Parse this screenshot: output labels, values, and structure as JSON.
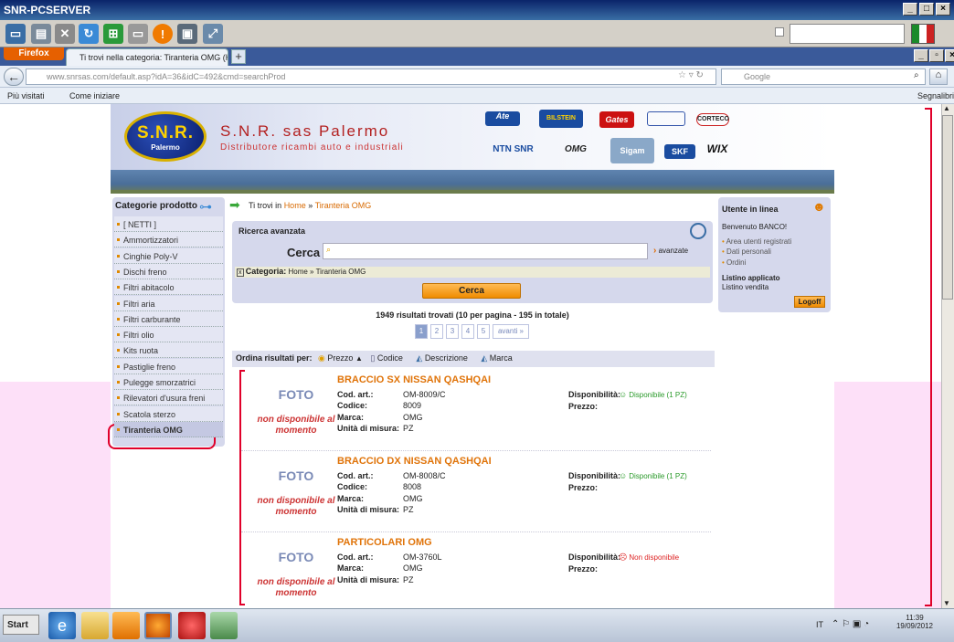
{
  "window": {
    "title": "SNR-PCSERVER"
  },
  "firefox": {
    "button_label": "Firefox",
    "tab_title": "Ti trovi nella categoria: Tiranteria OMG (Hom...",
    "url": "www.snrsas.com/default.asp?idA=36&idC=492&cmd=searchProd",
    "search_placeholder": "Google",
    "bookmarks": [
      "Più visitati",
      "Come iniziare"
    ],
    "bookmarks_right": "Segnalibri"
  },
  "site": {
    "logo_text": "S.N.R.",
    "logo_sub": "Palermo",
    "name": "S.N.R. sas Palermo",
    "tagline": "Distributore ricambi auto e industriali",
    "brands": [
      "Ate",
      "BILSTEIN",
      "Gates",
      "",
      "CORTECO",
      "NTN SNR",
      "OMG",
      "Sigam",
      "SKF",
      "WIX"
    ]
  },
  "sidebar": {
    "title": "Categorie prodotto",
    "items": [
      "[ NETTI ]",
      "Ammortizzatori",
      "Cinghie Poly-V",
      "Dischi freno",
      "Filtri abitacolo",
      "Filtri aria",
      "Filtri carburante",
      "Filtri olio",
      "Kits ruota",
      "Pastiglie freno",
      "Pulegge smorzatrici",
      "Rilevatori d'usura freni",
      "Scatola sterzo",
      "Tiranteria OMG"
    ]
  },
  "breadcrumb": {
    "prefix": "Ti trovi in",
    "home": "Home",
    "sep": "»",
    "current": "Tiranteria OMG"
  },
  "search": {
    "title": "Ricerca avanzata",
    "label": "Cerca",
    "advanced": "avanzate",
    "category_label": "Categoria:",
    "category_path": "Home » Tiranteria OMG",
    "button": "Cerca"
  },
  "results": {
    "summary": "1949 risultati trovati (10 per pagina - 195 in totale)",
    "pages": [
      "1",
      "2",
      "3",
      "4",
      "5"
    ],
    "next": "avanti »",
    "sort_label": "Ordina risultati per:",
    "sort": [
      "Prezzo",
      "Codice",
      "Descrizione",
      "Marca"
    ]
  },
  "labels": {
    "cod_art": "Cod. art.:",
    "codice": "Codice:",
    "marca": "Marca:",
    "unita": "Unità di misura:",
    "disp": "Disponibilità:",
    "prezzo": "Prezzo:",
    "foto": "FOTO",
    "foto_na": "non disponibile al momento"
  },
  "products": [
    {
      "name": "BRACCIO SX NISSAN QASHQAI",
      "cod_art": "OM-8009/C",
      "codice": "8009",
      "marca": "OMG",
      "unita": "PZ",
      "disp": "Disponibile (1 PZ)",
      "ok": true
    },
    {
      "name": "BRACCIO DX NISSAN QASHQAI",
      "cod_art": "OM-8008/C",
      "codice": "8008",
      "marca": "OMG",
      "unita": "PZ",
      "disp": "Disponibile (1 PZ)",
      "ok": true
    },
    {
      "name": "PARTICOLARI OMG",
      "cod_art": "OM-3760L",
      "codice": "",
      "marca": "OMG",
      "unita": "PZ",
      "disp": "Non disponibile",
      "ok": false
    }
  ],
  "user": {
    "title": "Utente in linea",
    "welcome": "Benvenuto BANCO!",
    "links": [
      "Area utenti registrati",
      "Dati personali",
      "Ordini"
    ],
    "listino_title": "Listino applicato",
    "listino": "Listino vendita",
    "logoff": "Logoff"
  },
  "taskbar": {
    "start": "Start",
    "lang": "IT",
    "time": "11:39",
    "date": "19/09/2012"
  }
}
